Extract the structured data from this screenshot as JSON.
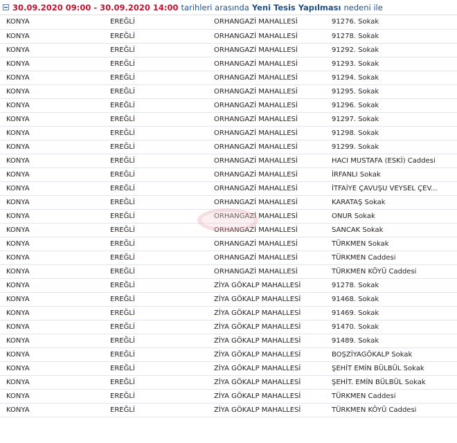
{
  "header": {
    "date_range": "30.09.2020 09:00 - 30.09.2020 14:00",
    "between_text": "tarihleri arasında",
    "reason": "Yeni Tesis Yapılması",
    "reason_suffix": "nedeni ile"
  },
  "watermark": {
    "text": "MEDAŞ"
  },
  "rows": [
    [
      "KONYA",
      "EREĞLİ",
      "ORHANGAZİ MAHALLESİ",
      "91276. Sokak"
    ],
    [
      "KONYA",
      "EREĞLİ",
      "ORHANGAZİ MAHALLESİ",
      "91278. Sokak"
    ],
    [
      "KONYA",
      "EREĞLİ",
      "ORHANGAZİ MAHALLESİ",
      "91292. Sokak"
    ],
    [
      "KONYA",
      "EREĞLİ",
      "ORHANGAZİ MAHALLESİ",
      "91293. Sokak"
    ],
    [
      "KONYA",
      "EREĞLİ",
      "ORHANGAZİ MAHALLESİ",
      "91294. Sokak"
    ],
    [
      "KONYA",
      "EREĞLİ",
      "ORHANGAZİ MAHALLESİ",
      "91295. Sokak"
    ],
    [
      "KONYA",
      "EREĞLİ",
      "ORHANGAZİ MAHALLESİ",
      "91296. Sokak"
    ],
    [
      "KONYA",
      "EREĞLİ",
      "ORHANGAZİ MAHALLESİ",
      "91297. Sokak"
    ],
    [
      "KONYA",
      "EREĞLİ",
      "ORHANGAZİ MAHALLESİ",
      "91298. Sokak"
    ],
    [
      "KONYA",
      "EREĞLİ",
      "ORHANGAZİ MAHALLESİ",
      "91299. Sokak"
    ],
    [
      "KONYA",
      "EREĞLİ",
      "ORHANGAZİ MAHALLESİ",
      "HACI MUSTAFA (ESKİ) Caddesi"
    ],
    [
      "KONYA",
      "EREĞLİ",
      "ORHANGAZİ MAHALLESİ",
      "İRFANLI Sokak"
    ],
    [
      "KONYA",
      "EREĞLİ",
      "ORHANGAZİ MAHALLESİ",
      "İTFAİYE ÇAVUŞU VEYSEL ÇEV..."
    ],
    [
      "KONYA",
      "EREĞLİ",
      "ORHANGAZİ MAHALLESİ",
      "KARATAŞ Sokak"
    ],
    [
      "KONYA",
      "EREĞLİ",
      "ORHANGAZİ MAHALLESİ",
      "ONUR Sokak"
    ],
    [
      "KONYA",
      "EREĞLİ",
      "ORHANGAZİ MAHALLESİ",
      "SANCAK Sokak"
    ],
    [
      "KONYA",
      "EREĞLİ",
      "ORHANGAZİ MAHALLESİ",
      "TÜRKMEN Sokak"
    ],
    [
      "KONYA",
      "EREĞLİ",
      "ORHANGAZİ MAHALLESİ",
      "TÜRKMEN Caddesi"
    ],
    [
      "KONYA",
      "EREĞLİ",
      "ORHANGAZİ MAHALLESİ",
      "TÜRKMEN KÖYÜ Caddesi"
    ],
    [
      "KONYA",
      "EREĞLİ",
      "ZİYA GÖKALP MAHALLESİ",
      "91278. Sokak"
    ],
    [
      "KONYA",
      "EREĞLİ",
      "ZİYA GÖKALP MAHALLESİ",
      "91468. Sokak"
    ],
    [
      "KONYA",
      "EREĞLİ",
      "ZİYA GÖKALP MAHALLESİ",
      "91469. Sokak"
    ],
    [
      "KONYA",
      "EREĞLİ",
      "ZİYA GÖKALP MAHALLESİ",
      "91470. Sokak"
    ],
    [
      "KONYA",
      "EREĞLİ",
      "ZİYA GÖKALP MAHALLESİ",
      "91489. Sokak"
    ],
    [
      "KONYA",
      "EREĞLİ",
      "ZİYA GÖKALP MAHALLESİ",
      "BOŞZİYAGÖKALP Sokak"
    ],
    [
      "KONYA",
      "EREĞLİ",
      "ZİYA GÖKALP MAHALLESİ",
      "ŞEHİT EMİN BÜLBÜL Sokak"
    ],
    [
      "KONYA",
      "EREĞLİ",
      "ZİYA GÖKALP MAHALLESİ",
      "ŞEHİT. EMİN BÜLBÜL Sokak"
    ],
    [
      "KONYA",
      "EREĞLİ",
      "ZİYA GÖKALP MAHALLESİ",
      "TÜRKMEN Caddesi"
    ],
    [
      "KONYA",
      "EREĞLİ",
      "ZİYA GÖKALP MAHALLESİ",
      "TÜRKMEN KÖYÜ Caddesi"
    ]
  ]
}
